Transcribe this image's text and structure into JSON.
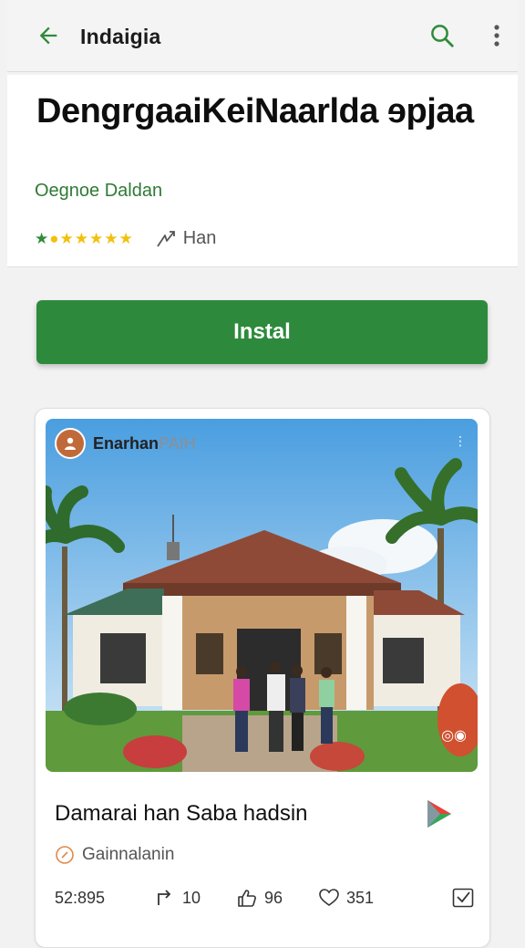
{
  "topbar": {
    "title": "Indaigia",
    "icons": {
      "back": "arrow-left-icon",
      "search": "search-icon",
      "more": "more-vert-icon"
    },
    "accent": "#2e8b3a"
  },
  "header": {
    "headline": "DengrgaaiKeiNaarlda ɘpjaa",
    "developer": "Oegnoe Daldan",
    "share_label": "Han",
    "rating_color": "#f3c00d"
  },
  "install": {
    "label": "Instal",
    "color": "#2d8a3c"
  },
  "post": {
    "page_name": "Enarhan",
    "page_name_suffix": "PAIH",
    "caption": "Damarai han Saba hadsin",
    "subtitle": "Gainnalanin",
    "stats": {
      "time": "52:895",
      "shares": "10",
      "likes": "96",
      "hearts": "351"
    }
  }
}
